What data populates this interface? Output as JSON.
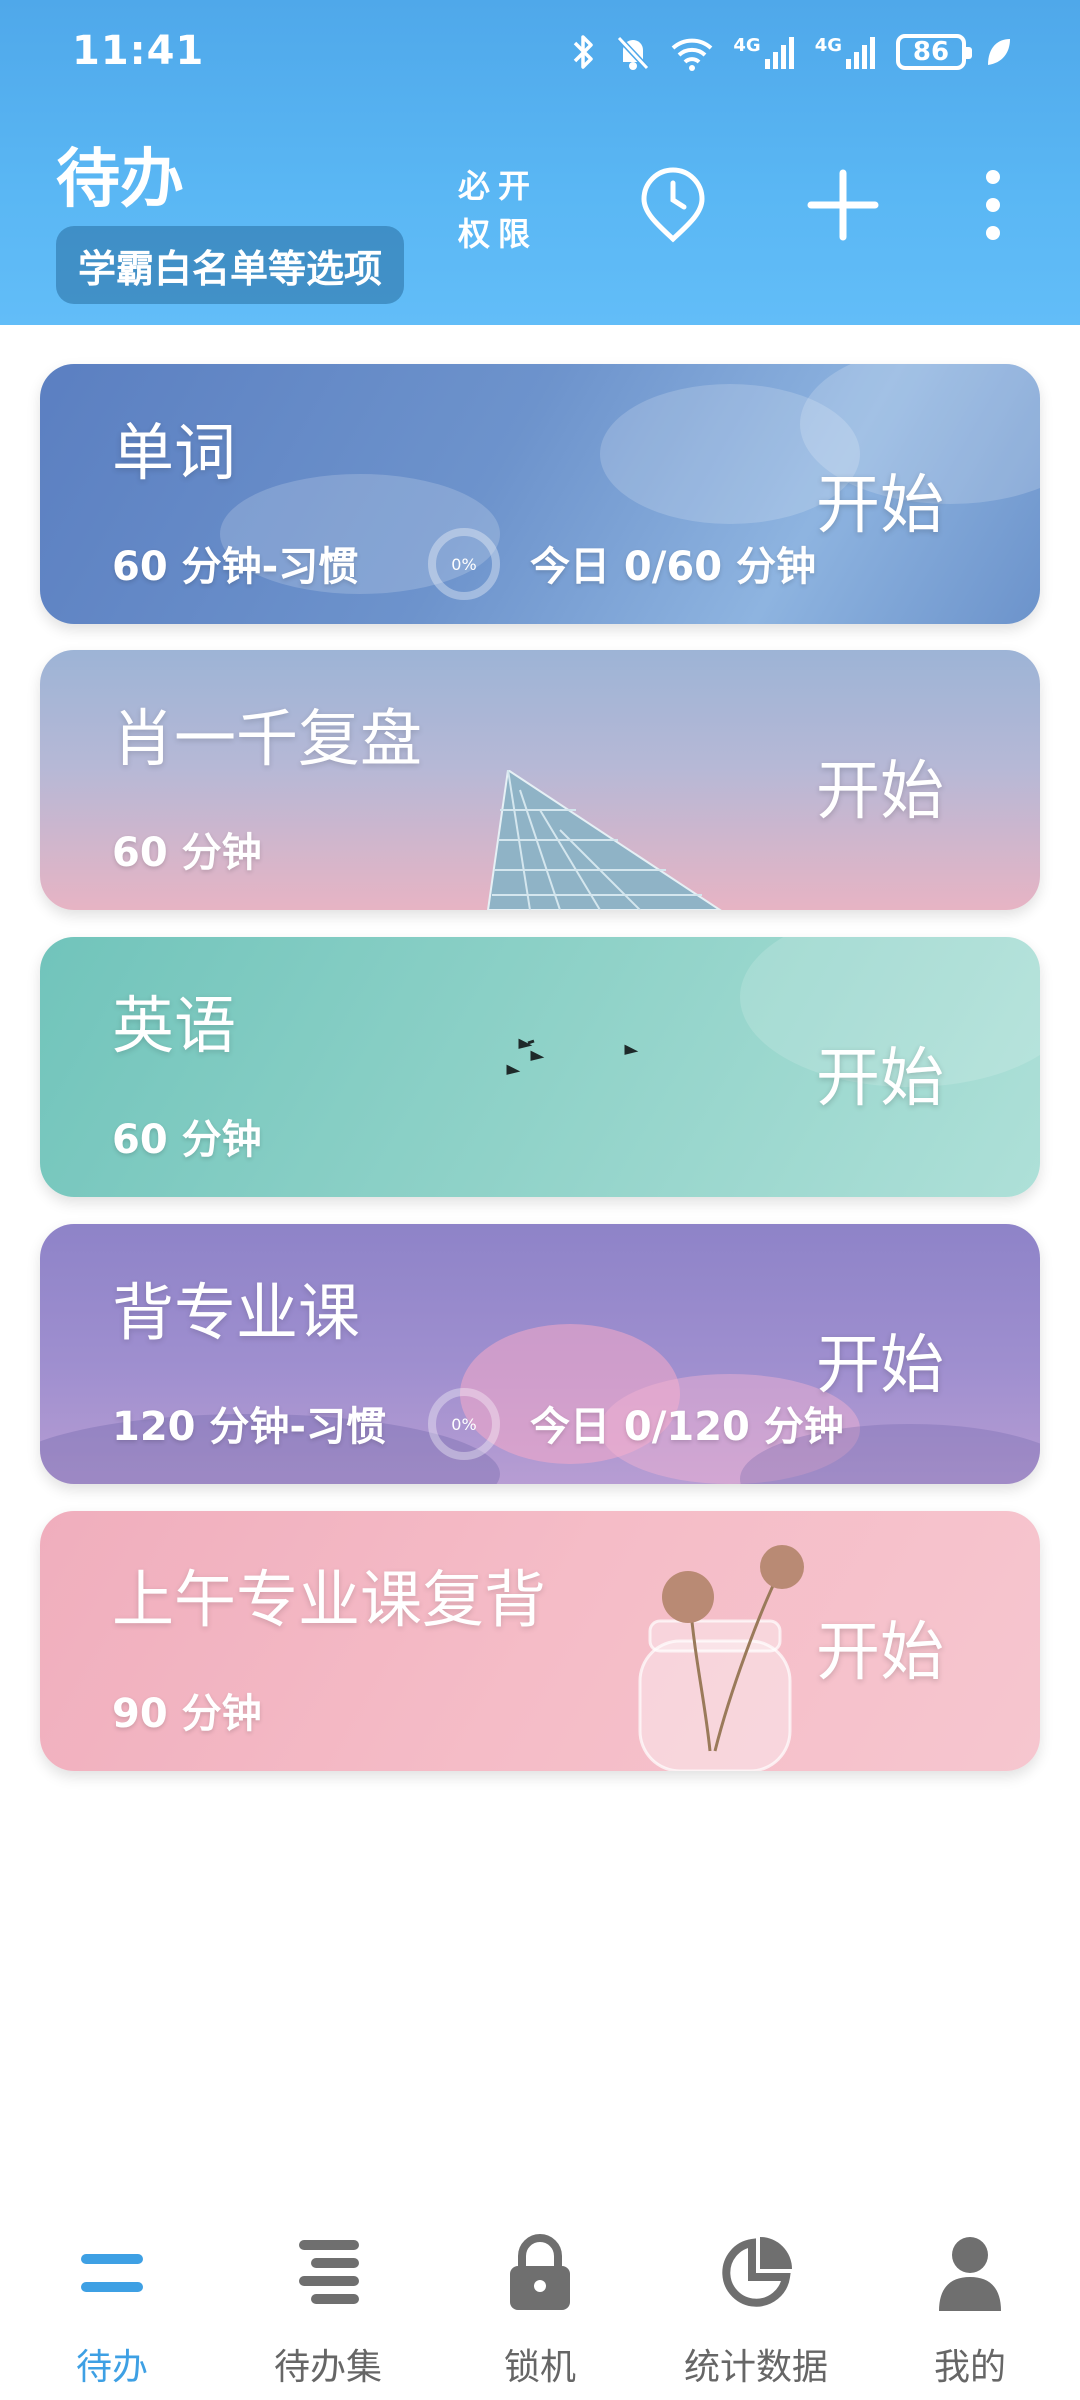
{
  "status": {
    "time": "11:41",
    "battery": "86",
    "net1": "4G",
    "net2": "4G"
  },
  "header": {
    "title": "待办",
    "whitelist_label": "学霸白名单等选项",
    "permission_line1": "必开",
    "permission_line2": "权限",
    "icons": [
      "clock-icon",
      "plus-icon",
      "more-vertical-icon"
    ]
  },
  "tasks": [
    {
      "title": "单词",
      "duration": "60 分钟-习惯",
      "progress_label": "0%",
      "today": "今日 0/60 分钟",
      "start": "开始"
    },
    {
      "title": "肖一千复盘",
      "duration": "60 分钟",
      "start": "开始"
    },
    {
      "title": "英语",
      "duration": "60 分钟",
      "start": "开始"
    },
    {
      "title": "背专业课",
      "duration": "120 分钟-习惯",
      "progress_label": "0%",
      "today": "今日 0/120 分钟",
      "start": "开始"
    },
    {
      "title": "上午专业课复背",
      "duration": "90 分钟",
      "start": "开始"
    }
  ],
  "nav": [
    {
      "label": "待办",
      "icon": "todo-icon",
      "active": true
    },
    {
      "label": "待办集",
      "icon": "todo-set-icon"
    },
    {
      "label": "锁机",
      "icon": "lock-icon"
    },
    {
      "label": "统计数据",
      "icon": "pie-chart-icon"
    },
    {
      "label": "我的",
      "icon": "user-icon"
    }
  ],
  "colors": {
    "header": "#5ab7f4",
    "accent": "#3ea0e4",
    "nav_inactive": "#666666"
  }
}
